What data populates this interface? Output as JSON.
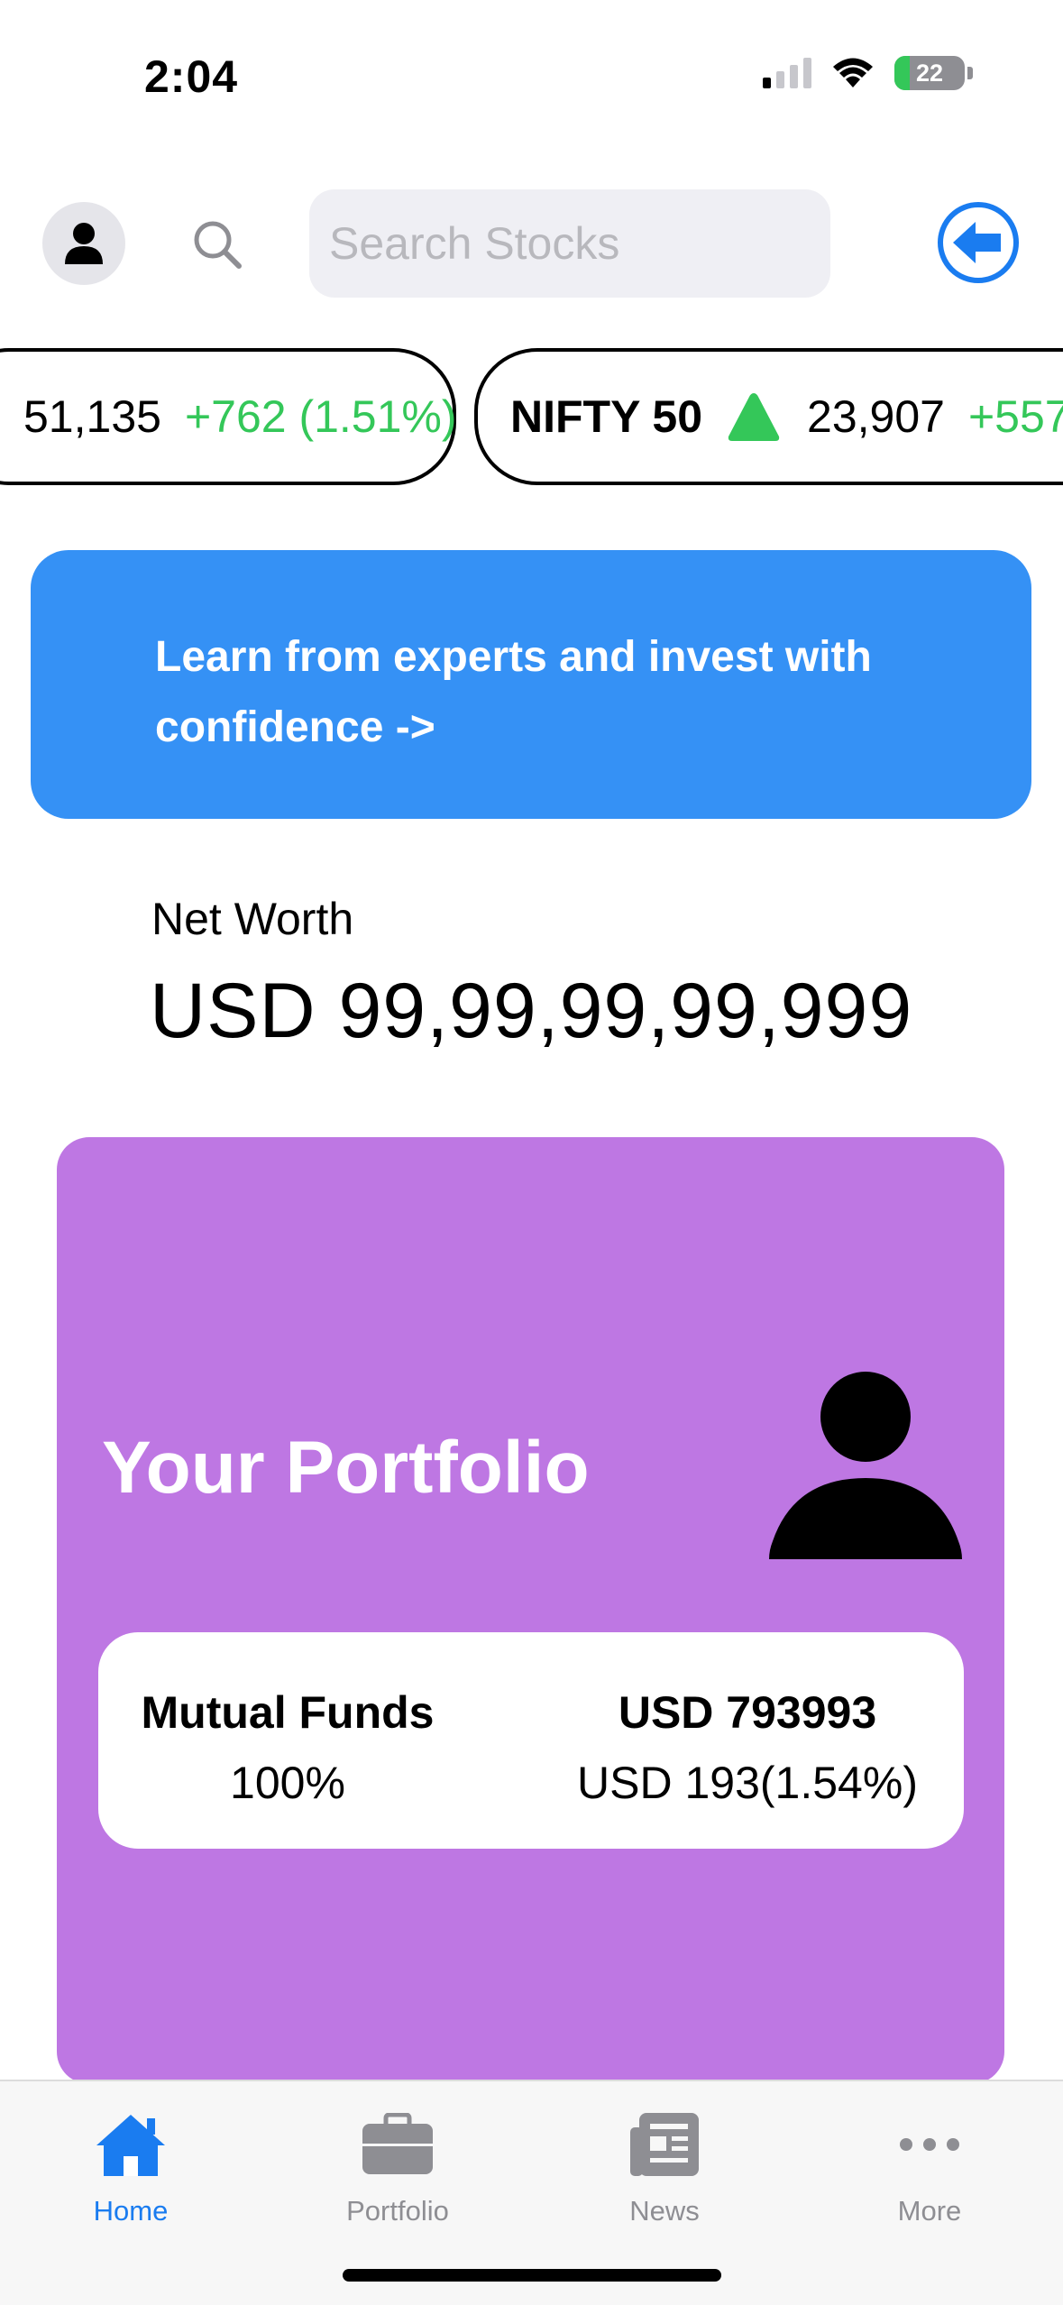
{
  "status_bar": {
    "time": "2:04",
    "battery": "22",
    "battery_level_percent": 22
  },
  "header": {
    "search_placeholder": "Search Stocks",
    "icons": [
      "person-icon",
      "search-icon",
      "back-arrow-icon"
    ],
    "accent_color": "#1a7cf0"
  },
  "ticker": [
    {
      "name": "",
      "value": "51,135",
      "change": "+762 (1.51%)",
      "direction": "up"
    },
    {
      "name": "NIFTY 50",
      "value": "23,907",
      "change": "+557",
      "direction": "up"
    }
  ],
  "banner": {
    "text": "Learn from experts and invest with confidence ->",
    "color": "#3591f5"
  },
  "net_worth": {
    "label": "Net Worth",
    "value": "USD 99,99,99,99,999"
  },
  "portfolio": {
    "title": "Your Portfolio",
    "color": "#be77e3",
    "category": "Mutual Funds",
    "share": "100%",
    "amount": "USD 793993",
    "gain": "USD 193(1.54%)"
  },
  "tabs": [
    {
      "label": "Home",
      "icon": "home-icon",
      "active": true
    },
    {
      "label": "Portfolio",
      "icon": "briefcase-icon",
      "active": false
    },
    {
      "label": "News",
      "icon": "newspaper-icon",
      "active": false
    },
    {
      "label": "More",
      "icon": "more-icon",
      "active": false
    }
  ]
}
